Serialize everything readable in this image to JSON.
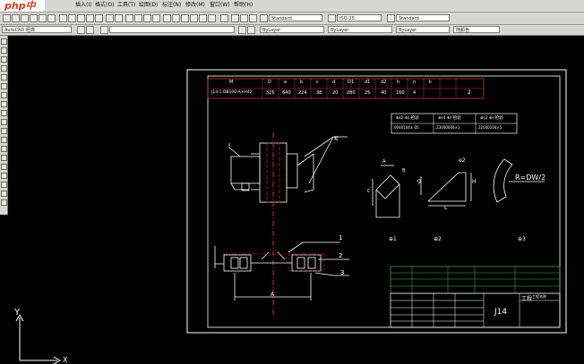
{
  "brand": {
    "logo_text": "php中文网"
  },
  "menu": {
    "items": [
      "插入(I)",
      "格式(O)",
      "工具(T)",
      "绘图(D)",
      "标注(N)",
      "修改(M)",
      "窗口(W)",
      "帮助(H)"
    ]
  },
  "toolbar": {
    "text_style": "Standard",
    "dim_style": "ISO-25",
    "table_style": "Standard",
    "workspace": "AutoCAD 经典",
    "layer_color": "ByLayer",
    "linetype": "ByLayer",
    "lineweight": "ByLayer",
    "plot_style": "随颜色"
  },
  "table": {
    "header": [
      "M",
      "D",
      "a",
      "b",
      "c",
      "d",
      "D1",
      "d1",
      "d2",
      "h",
      "n",
      "k"
    ],
    "row": [
      "J14-1 DB100 A×H42",
      "325",
      "640",
      "224",
      "38",
      "20",
      "280",
      "25",
      "40",
      "160",
      "4",
      "2"
    ]
  },
  "tolerance_box": {
    "headers": [
      "⊕(2 ⊕) 检验",
      "⊕(4 ⊕) 检验",
      "⊕(3 ⊕) 检验"
    ],
    "values": [
      "0040104±.05",
      "Z3040004±1",
      "22040104±5"
    ]
  },
  "labels": {
    "k": "K",
    "a": "A",
    "c": "C",
    "b": "B",
    "e2": "e2",
    "h": "H",
    "l": "L",
    "rdw": "R=DW/2",
    "g": "g",
    "n1": "1",
    "n2": "2",
    "n3": "3",
    "cap1": "⊕1",
    "cap2": "⊕2",
    "cap3": "⊕3",
    "y": "Y",
    "x": "X"
  },
  "title_block": {
    "drawing_no": "J14",
    "title": "工程",
    "sub": "工程名称"
  }
}
